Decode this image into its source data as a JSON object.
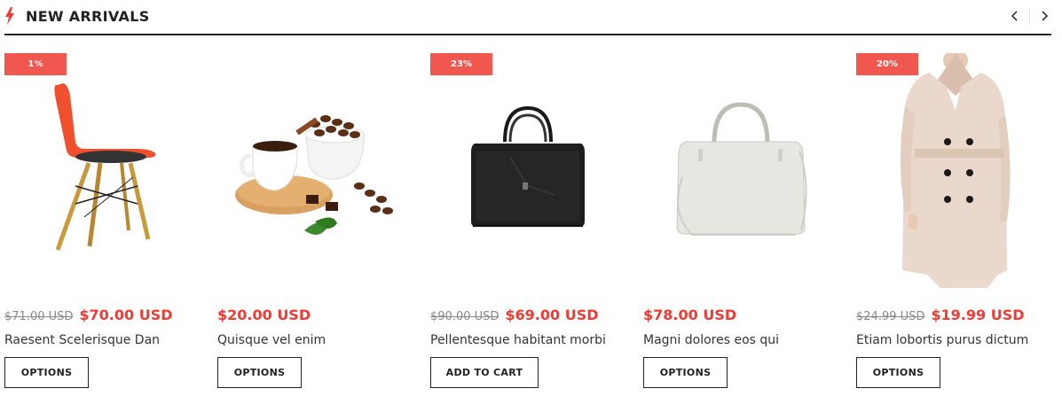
{
  "section": {
    "title": "NEW ARRIVALS",
    "prev_icon": "chevron-left-icon",
    "next_icon": "chevron-right-icon",
    "icon": "lightning-icon"
  },
  "colors": {
    "accent": "#ef3b33",
    "badge": "#f0574f",
    "text": "#222222"
  },
  "products": [
    {
      "badge": "1%",
      "old_price": "$71.00 USD",
      "price": "$70.00 USD",
      "name": "Raesent Scelerisque Dan",
      "button": "OPTIONS",
      "image": "orange chair"
    },
    {
      "badge": "",
      "old_price": "",
      "price": "$20.00 USD",
      "name": "Quisque vel enim",
      "button": "OPTIONS",
      "image": "coffee cup with beans"
    },
    {
      "badge": "23%",
      "old_price": "$90.00 USD",
      "price": "$69.00 USD",
      "name": "Pellentesque habitant morbi",
      "button": "ADD TO CART",
      "image": "black handbag"
    },
    {
      "badge": "",
      "old_price": "",
      "price": "$78.00 USD",
      "name": "Magni dolores eos qui",
      "button": "OPTIONS",
      "image": "white handbag"
    },
    {
      "badge": "20%",
      "old_price": "$24.99 USD",
      "price": "$19.99 USD",
      "name": "Etiam lobortis purus dictum",
      "button": "OPTIONS",
      "image": "beige trench coat"
    }
  ]
}
